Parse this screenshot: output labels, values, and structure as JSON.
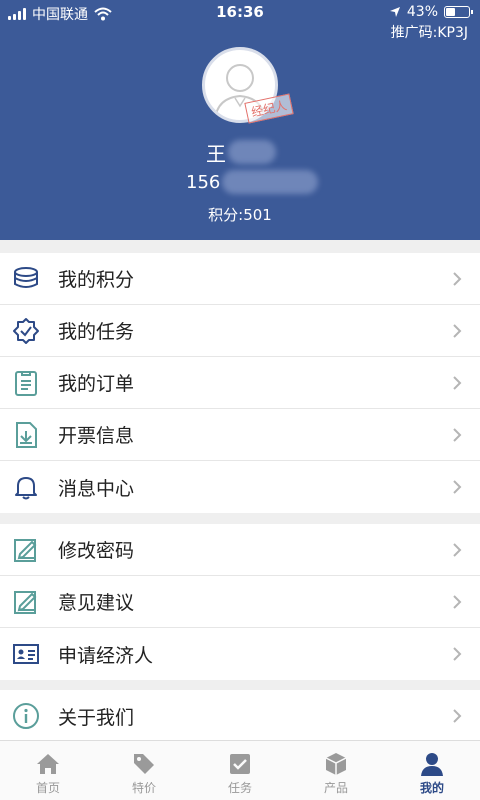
{
  "status_bar": {
    "carrier": "中国联通",
    "time": "16:36",
    "battery": "43%",
    "battery_level": 0.43
  },
  "profile": {
    "promo_code": "推广码:KP3J",
    "stamp_text": "经纪人",
    "name": "王",
    "phone": "156",
    "points": "积分:501"
  },
  "menu_groups": [
    [
      {
        "label": "我的积分",
        "icon": "database-icon"
      },
      {
        "label": "我的任务",
        "icon": "badge-check-icon"
      },
      {
        "label": "我的订单",
        "icon": "clipboard-list-icon"
      },
      {
        "label": "开票信息",
        "icon": "invoice-icon"
      },
      {
        "label": "消息中心",
        "icon": "bell-icon"
      }
    ],
    [
      {
        "label": "修改密码",
        "icon": "edit-document-icon"
      },
      {
        "label": "意见建议",
        "icon": "feedback-edit-icon"
      },
      {
        "label": "申请经济人",
        "icon": "id-card-icon"
      }
    ],
    [
      {
        "label": "关于我们",
        "icon": "info-icon"
      }
    ]
  ],
  "tabs": [
    {
      "label": "首页",
      "icon": "home-icon",
      "active": false
    },
    {
      "label": "特价",
      "icon": "tag-icon",
      "active": false
    },
    {
      "label": "任务",
      "icon": "task-check-icon",
      "active": false
    },
    {
      "label": "产品",
      "icon": "cube-icon",
      "active": false
    },
    {
      "label": "我的",
      "icon": "user-icon",
      "active": true
    }
  ],
  "colors": {
    "header_bg": "#3c5a98",
    "icon_blue": "#2d4a87",
    "icon_teal": "#5a9e9a",
    "tab_inactive": "#9a9a9a",
    "tab_active": "#2d4a87"
  }
}
